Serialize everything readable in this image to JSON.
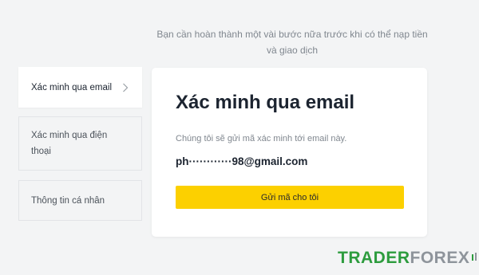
{
  "header": {
    "note": "Bạn cần hoàn thành một vài bước nữa trước khi có thể nạp tiền và giao dịch"
  },
  "sidebar": {
    "items": [
      {
        "label": "Xác minh qua email",
        "active": true,
        "icon": "chevron-right-icon"
      },
      {
        "label": "Xác minh qua điện thoại",
        "active": false
      },
      {
        "label": "Thông tin cá nhân",
        "active": false
      }
    ]
  },
  "card": {
    "title": "Xác minh qua email",
    "description": "Chúng tôi sẽ gửi mã xác minh tới email này.",
    "email": "ph············98@gmail.com",
    "button_label": "Gửi mã cho tôi"
  },
  "watermark": {
    "part1": "TRADER",
    "part2": "FOREX"
  },
  "colors": {
    "accent": "#fcd000",
    "background": "#f3f4f5",
    "watermark_green": "#2d9c3e"
  }
}
